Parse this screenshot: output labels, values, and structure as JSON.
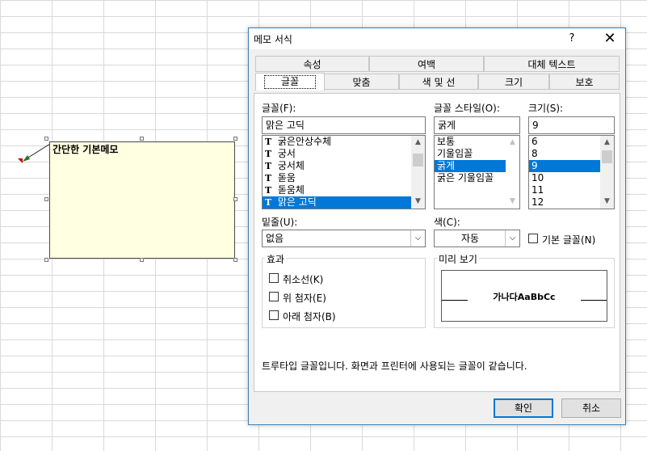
{
  "memo": {
    "text": "간단한 기본메모"
  },
  "dialog": {
    "title": "메모 서식",
    "help": "?",
    "close": "✕",
    "tabs_row1": [
      "속성",
      "여백",
      "대체 텍스트"
    ],
    "tabs_row2": [
      "글꼴",
      "맞춤",
      "색 및 선",
      "크기",
      "보호"
    ],
    "active_tab": "글꼴",
    "font": {
      "label": "글꼴(F):",
      "value": "맑은 고딕",
      "items": [
        "굵은안상수체",
        "궁서",
        "궁서체",
        "돋움",
        "돋움체",
        "맑은 고딕"
      ],
      "selected": "맑은 고딕"
    },
    "style": {
      "label": "글꼴 스타일(O):",
      "value": "굵게",
      "items": [
        "보통",
        "기울임꼴",
        "굵게",
        "굵은 기울임꼴"
      ],
      "selected": "굵게"
    },
    "size": {
      "label": "크기(S):",
      "value": "9",
      "items": [
        "6",
        "8",
        "9",
        "10",
        "11",
        "12"
      ],
      "selected": "9"
    },
    "underline": {
      "label": "밑줄(U):",
      "value": "없음"
    },
    "color": {
      "label": "색(C):",
      "value": "자동"
    },
    "default_font": {
      "label": "기본 글꼴(N)",
      "checked": false
    },
    "effects": {
      "label": "효과",
      "strikethrough": "취소선(K)",
      "superscript": "위 첨자(E)",
      "subscript": "아래 첨자(B)"
    },
    "preview": {
      "label": "미리 보기",
      "sample": "가나다AaBbCc"
    },
    "info": "트루타입 글꼴입니다. 화면과 프린터에 사용되는 글꼴이 같습니다.",
    "ok": "확인",
    "cancel": "취소"
  },
  "colors": {
    "accent": "#0078d7",
    "memo_bg": "#ffffe1",
    "comment_marker": "#d00000"
  }
}
